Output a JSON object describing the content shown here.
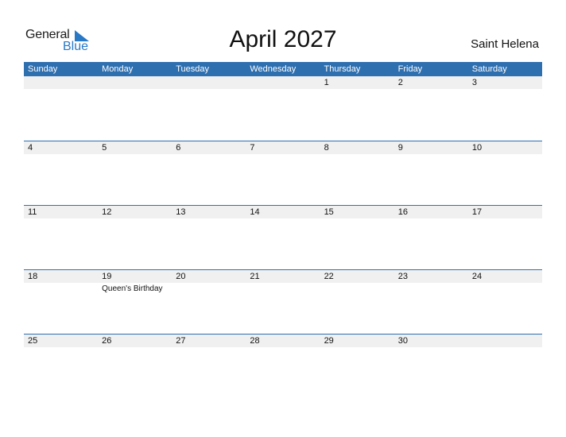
{
  "logo": {
    "text_general": "General",
    "text_blue": "Blue",
    "icon": "triangle-flag-icon"
  },
  "title": "April 2027",
  "country": "Saint Helena",
  "colors": {
    "header_bg": "#2e6fb0",
    "strip_bg": "#f0f0f0",
    "logo_blue": "#2979c7"
  },
  "weekdays": [
    "Sunday",
    "Monday",
    "Tuesday",
    "Wednesday",
    "Thursday",
    "Friday",
    "Saturday"
  ],
  "weeks": [
    {
      "days": [
        {
          "num": ""
        },
        {
          "num": ""
        },
        {
          "num": ""
        },
        {
          "num": ""
        },
        {
          "num": "1"
        },
        {
          "num": "2"
        },
        {
          "num": "3"
        }
      ]
    },
    {
      "days": [
        {
          "num": "4"
        },
        {
          "num": "5"
        },
        {
          "num": "6"
        },
        {
          "num": "7"
        },
        {
          "num": "8"
        },
        {
          "num": "9"
        },
        {
          "num": "10"
        }
      ]
    },
    {
      "days": [
        {
          "num": "11"
        },
        {
          "num": "12"
        },
        {
          "num": "13"
        },
        {
          "num": "14"
        },
        {
          "num": "15"
        },
        {
          "num": "16"
        },
        {
          "num": "17"
        }
      ]
    },
    {
      "days": [
        {
          "num": "18"
        },
        {
          "num": "19",
          "holiday": "Queen's Birthday"
        },
        {
          "num": "20"
        },
        {
          "num": "21"
        },
        {
          "num": "22"
        },
        {
          "num": "23"
        },
        {
          "num": "24"
        }
      ]
    },
    {
      "days": [
        {
          "num": "25"
        },
        {
          "num": "26"
        },
        {
          "num": "27"
        },
        {
          "num": "28"
        },
        {
          "num": "29"
        },
        {
          "num": "30"
        },
        {
          "num": ""
        }
      ]
    }
  ]
}
